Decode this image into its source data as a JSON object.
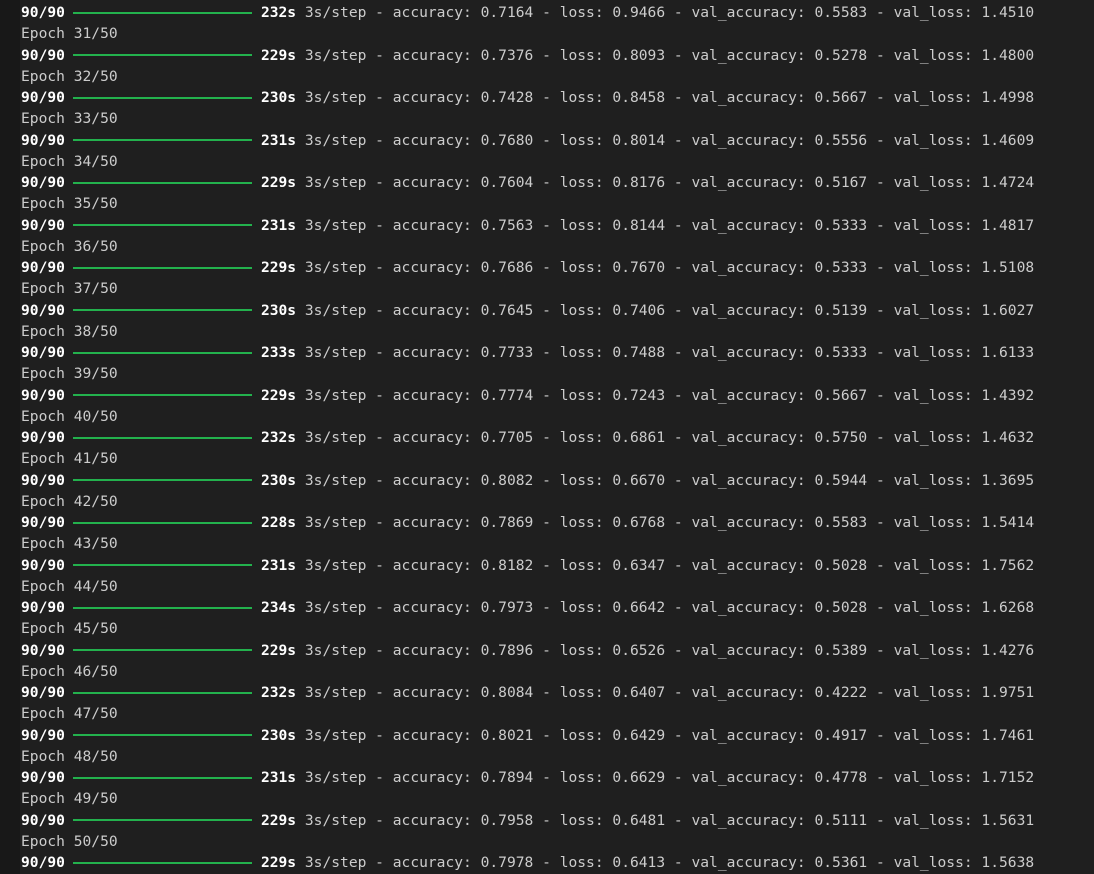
{
  "theme": {
    "background": "#1f1f1f",
    "text": "#cccccc",
    "bold_text": "#ffffff",
    "progress_color": "#23b14d"
  },
  "log": [
    {
      "type": "step",
      "steps": "90/90",
      "secs": "232s",
      "rest": "3s/step - accuracy: 0.7164 - loss: 0.9466 - val_accuracy: 0.5583 - val_loss: 1.4510"
    },
    {
      "type": "epoch",
      "text": "Epoch 31/50"
    },
    {
      "type": "step",
      "steps": "90/90",
      "secs": "229s",
      "rest": "3s/step - accuracy: 0.7376 - loss: 0.8093 - val_accuracy: 0.5278 - val_loss: 1.4800"
    },
    {
      "type": "epoch",
      "text": "Epoch 32/50"
    },
    {
      "type": "step",
      "steps": "90/90",
      "secs": "230s",
      "rest": "3s/step - accuracy: 0.7428 - loss: 0.8458 - val_accuracy: 0.5667 - val_loss: 1.4998"
    },
    {
      "type": "epoch",
      "text": "Epoch 33/50"
    },
    {
      "type": "step",
      "steps": "90/90",
      "secs": "231s",
      "rest": "3s/step - accuracy: 0.7680 - loss: 0.8014 - val_accuracy: 0.5556 - val_loss: 1.4609"
    },
    {
      "type": "epoch",
      "text": "Epoch 34/50"
    },
    {
      "type": "step",
      "steps": "90/90",
      "secs": "229s",
      "rest": "3s/step - accuracy: 0.7604 - loss: 0.8176 - val_accuracy: 0.5167 - val_loss: 1.4724"
    },
    {
      "type": "epoch",
      "text": "Epoch 35/50"
    },
    {
      "type": "step",
      "steps": "90/90",
      "secs": "231s",
      "rest": "3s/step - accuracy: 0.7563 - loss: 0.8144 - val_accuracy: 0.5333 - val_loss: 1.4817"
    },
    {
      "type": "epoch",
      "text": "Epoch 36/50"
    },
    {
      "type": "step",
      "steps": "90/90",
      "secs": "229s",
      "rest": "3s/step - accuracy: 0.7686 - loss: 0.7670 - val_accuracy: 0.5333 - val_loss: 1.5108"
    },
    {
      "type": "epoch",
      "text": "Epoch 37/50"
    },
    {
      "type": "step",
      "steps": "90/90",
      "secs": "230s",
      "rest": "3s/step - accuracy: 0.7645 - loss: 0.7406 - val_accuracy: 0.5139 - val_loss: 1.6027"
    },
    {
      "type": "epoch",
      "text": "Epoch 38/50"
    },
    {
      "type": "step",
      "steps": "90/90",
      "secs": "233s",
      "rest": "3s/step - accuracy: 0.7733 - loss: 0.7488 - val_accuracy: 0.5333 - val_loss: 1.6133"
    },
    {
      "type": "epoch",
      "text": "Epoch 39/50"
    },
    {
      "type": "step",
      "steps": "90/90",
      "secs": "229s",
      "rest": "3s/step - accuracy: 0.7774 - loss: 0.7243 - val_accuracy: 0.5667 - val_loss: 1.4392"
    },
    {
      "type": "epoch",
      "text": "Epoch 40/50"
    },
    {
      "type": "step",
      "steps": "90/90",
      "secs": "232s",
      "rest": "3s/step - accuracy: 0.7705 - loss: 0.6861 - val_accuracy: 0.5750 - val_loss: 1.4632"
    },
    {
      "type": "epoch",
      "text": "Epoch 41/50"
    },
    {
      "type": "step",
      "steps": "90/90",
      "secs": "230s",
      "rest": "3s/step - accuracy: 0.8082 - loss: 0.6670 - val_accuracy: 0.5944 - val_loss: 1.3695"
    },
    {
      "type": "epoch",
      "text": "Epoch 42/50"
    },
    {
      "type": "step",
      "steps": "90/90",
      "secs": "228s",
      "rest": "3s/step - accuracy: 0.7869 - loss: 0.6768 - val_accuracy: 0.5583 - val_loss: 1.5414"
    },
    {
      "type": "epoch",
      "text": "Epoch 43/50"
    },
    {
      "type": "step",
      "steps": "90/90",
      "secs": "231s",
      "rest": "3s/step - accuracy: 0.8182 - loss: 0.6347 - val_accuracy: 0.5028 - val_loss: 1.7562"
    },
    {
      "type": "epoch",
      "text": "Epoch 44/50"
    },
    {
      "type": "step",
      "steps": "90/90",
      "secs": "234s",
      "rest": "3s/step - accuracy: 0.7973 - loss: 0.6642 - val_accuracy: 0.5028 - val_loss: 1.6268"
    },
    {
      "type": "epoch",
      "text": "Epoch 45/50"
    },
    {
      "type": "step",
      "steps": "90/90",
      "secs": "229s",
      "rest": "3s/step - accuracy: 0.7896 - loss: 0.6526 - val_accuracy: 0.5389 - val_loss: 1.4276"
    },
    {
      "type": "epoch",
      "text": "Epoch 46/50"
    },
    {
      "type": "step",
      "steps": "90/90",
      "secs": "232s",
      "rest": "3s/step - accuracy: 0.8084 - loss: 0.6407 - val_accuracy: 0.4222 - val_loss: 1.9751"
    },
    {
      "type": "epoch",
      "text": "Epoch 47/50"
    },
    {
      "type": "step",
      "steps": "90/90",
      "secs": "230s",
      "rest": "3s/step - accuracy: 0.8021 - loss: 0.6429 - val_accuracy: 0.4917 - val_loss: 1.7461"
    },
    {
      "type": "epoch",
      "text": "Epoch 48/50"
    },
    {
      "type": "step",
      "steps": "90/90",
      "secs": "231s",
      "rest": "3s/step - accuracy: 0.7894 - loss: 0.6629 - val_accuracy: 0.4778 - val_loss: 1.7152"
    },
    {
      "type": "epoch",
      "text": "Epoch 49/50"
    },
    {
      "type": "step",
      "steps": "90/90",
      "secs": "229s",
      "rest": "3s/step - accuracy: 0.7958 - loss: 0.6481 - val_accuracy: 0.5111 - val_loss: 1.5631"
    },
    {
      "type": "epoch",
      "text": "Epoch 50/50"
    },
    {
      "type": "step",
      "steps": "90/90",
      "secs": "229s",
      "rest": "3s/step - accuracy: 0.7978 - loss: 0.6413 - val_accuracy: 0.5361 - val_loss: 1.5638"
    }
  ]
}
